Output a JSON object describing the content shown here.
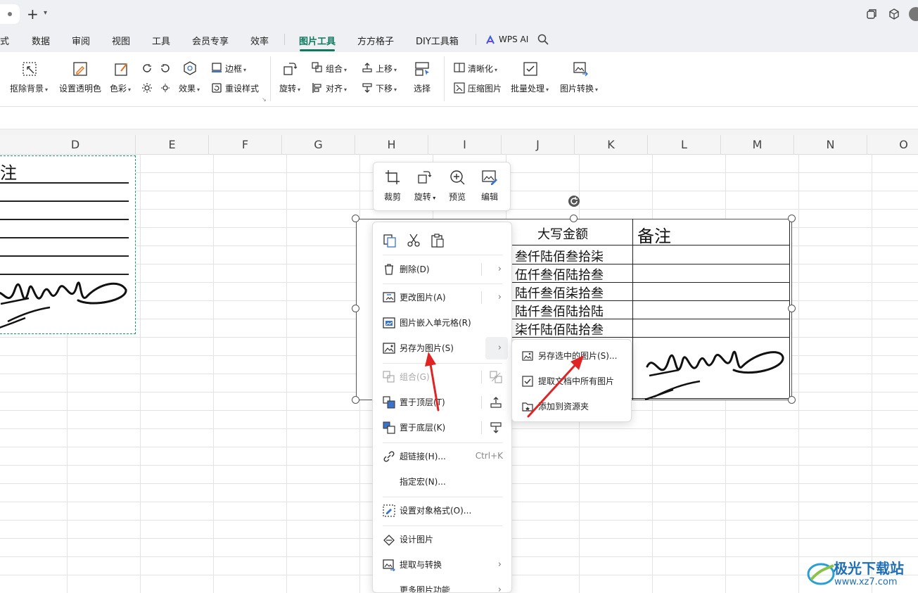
{
  "menubar": {
    "items": [
      {
        "label": "式"
      },
      {
        "label": "数据"
      },
      {
        "label": "审阅"
      },
      {
        "label": "视图"
      },
      {
        "label": "工具"
      },
      {
        "label": "会员专享"
      },
      {
        "label": "效率"
      },
      {
        "label": "图片工具"
      },
      {
        "label": "方方格子"
      },
      {
        "label": "DIY工具箱"
      },
      {
        "label": "WPS AI"
      }
    ],
    "active_color": "#0d7a5f"
  },
  "ribbon": {
    "remove_bg": "抠除背景",
    "set_transparent": "设置透明色",
    "color": "色彩",
    "effect": "效果",
    "border": "边框",
    "reset_style": "重设样式",
    "rotate": "旋转",
    "group": "组合",
    "align": "对齐",
    "move_up": "上移",
    "move_down": "下移",
    "select": "选择",
    "sharpen": "清晰化",
    "compress": "压缩图片",
    "batch": "批量处理",
    "convert": "图片转换"
  },
  "columns": [
    "D",
    "E",
    "F",
    "G",
    "H",
    "I",
    "J",
    "K",
    "L",
    "M",
    "N",
    "O"
  ],
  "left_table": {
    "header": "注"
  },
  "image_table": {
    "col_header_amount": "大写金额",
    "col_header_note": "备注",
    "amounts": [
      "叁仟陆佰叁拾柒",
      "伍仟叁佰陆拾叁",
      "陆仟叁佰柒拾叁",
      "陆仟叁佰陆拾陆",
      "柒仟陆佰陆拾叁"
    ]
  },
  "float_toolbar": {
    "crop": "裁剪",
    "rotate": "旋转",
    "preview": "预览",
    "edit": "编辑"
  },
  "context_menu": {
    "delete": "删除(D)",
    "change_picture": "更改图片(A)",
    "embed_in_cell": "图片嵌入单元格(R)",
    "save_as_picture": "另存为图片(S)",
    "group": "组合(G)",
    "bring_to_front": "置于顶层(T)",
    "send_to_back": "置于底层(K)",
    "hyperlink": "超链接(H)...",
    "hyperlink_shortcut": "Ctrl+K",
    "assign_macro": "指定宏(N)...",
    "format_object": "设置对象格式(O)...",
    "design_picture": "设计图片",
    "extract_convert": "提取与转换",
    "more_picture_features": "更多图片功能"
  },
  "submenu": {
    "save_selected": "另存选中的图片(S)...",
    "extract_all": "提取文档中所有图片",
    "add_to_resources": "添加到资源夹"
  },
  "watermark": {
    "name": "极光下载站",
    "url": "www.xz7.com"
  },
  "colors": {
    "accent": "#0d7a5f",
    "arrow": "#e02424",
    "selection_dash": "#1a9a6e"
  }
}
